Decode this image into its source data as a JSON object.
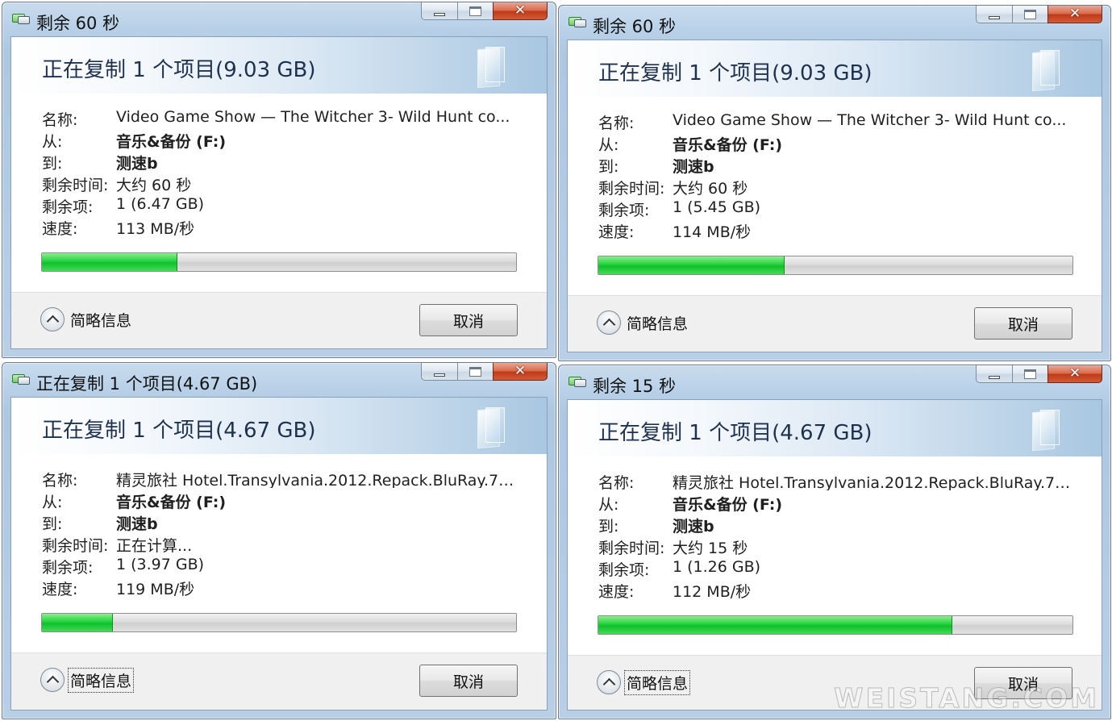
{
  "dialogs": [
    {
      "title": "剩余 60 秒",
      "heading": "正在复制 1 个项目(9.03 GB)",
      "rows": [
        {
          "label": "名称:",
          "value": "Video Game Show — The Witcher 3- Wild Hunt co..."
        },
        {
          "label": "从:",
          "value": "音乐&备份 (F:)"
        },
        {
          "label": "到:",
          "value": "测速b"
        },
        {
          "label": "剩余时间:",
          "value": "大约 60 秒"
        },
        {
          "label": "剩余项:",
          "value": "1 (6.47 GB)"
        },
        {
          "label": "速度:",
          "value": "113 MB/秒"
        }
      ],
      "progress": 0.285,
      "details_label": "简略信息",
      "cancel_label": "取消",
      "active": true,
      "details_focused": false
    },
    {
      "title": "剩余 60 秒",
      "heading": "正在复制 1 个项目(9.03 GB)",
      "rows": [
        {
          "label": "名称:",
          "value": "Video Game Show — The Witcher 3- Wild Hunt co..."
        },
        {
          "label": "从:",
          "value": "音乐&备份 (F:)"
        },
        {
          "label": "到:",
          "value": "测速b"
        },
        {
          "label": "剩余时间:",
          "value": "大约 60 秒"
        },
        {
          "label": "剩余项:",
          "value": "1 (5.45 GB)"
        },
        {
          "label": "速度:",
          "value": "114 MB/秒"
        }
      ],
      "progress": 0.393,
      "details_label": "简略信息",
      "cancel_label": "取消",
      "active": true,
      "details_focused": false
    },
    {
      "title": "正在复制 1 个项目(4.67 GB)",
      "heading": "正在复制 1 个项目(4.67 GB)",
      "rows": [
        {
          "label": "名称:",
          "value": "精灵旅社 Hotel.Transylvania.2012.Repack.BluRay.72..."
        },
        {
          "label": "从:",
          "value": "音乐&备份 (F:)"
        },
        {
          "label": "到:",
          "value": "测速b"
        },
        {
          "label": "剩余时间:",
          "value": "正在计算..."
        },
        {
          "label": "剩余项:",
          "value": "1 (3.97 GB)"
        },
        {
          "label": "速度:",
          "value": "119 MB/秒"
        }
      ],
      "progress": 0.15,
      "details_label": "简略信息",
      "cancel_label": "取消",
      "active": true,
      "details_focused": true
    },
    {
      "title": "剩余 15 秒",
      "heading": "正在复制 1 个项目(4.67 GB)",
      "rows": [
        {
          "label": "名称:",
          "value": "精灵旅社 Hotel.Transylvania.2012.Repack.BluRay.72..."
        },
        {
          "label": "从:",
          "value": "音乐&备份 (F:)"
        },
        {
          "label": "到:",
          "value": "测速b"
        },
        {
          "label": "剩余时间:",
          "value": "大约 15 秒"
        },
        {
          "label": "剩余项:",
          "value": "1 (1.26 GB)"
        },
        {
          "label": "速度:",
          "value": "112 MB/秒"
        }
      ],
      "progress": 0.747,
      "details_label": "简略信息",
      "cancel_label": "取消",
      "active": true,
      "details_focused": true
    }
  ],
  "icons": {
    "title_icon": "copy-files-icon",
    "minimize": "minimize-icon",
    "maximize": "maximize-icon",
    "close": "close-icon",
    "details_toggle": "chevron-up-icon",
    "banner_art": "glass-pane-icon"
  },
  "colors": {
    "progress_fill": "#1ec83a",
    "close_button": "#c9452a",
    "banner_text": "#1e3250"
  },
  "watermark": "WEISTANG.COM"
}
